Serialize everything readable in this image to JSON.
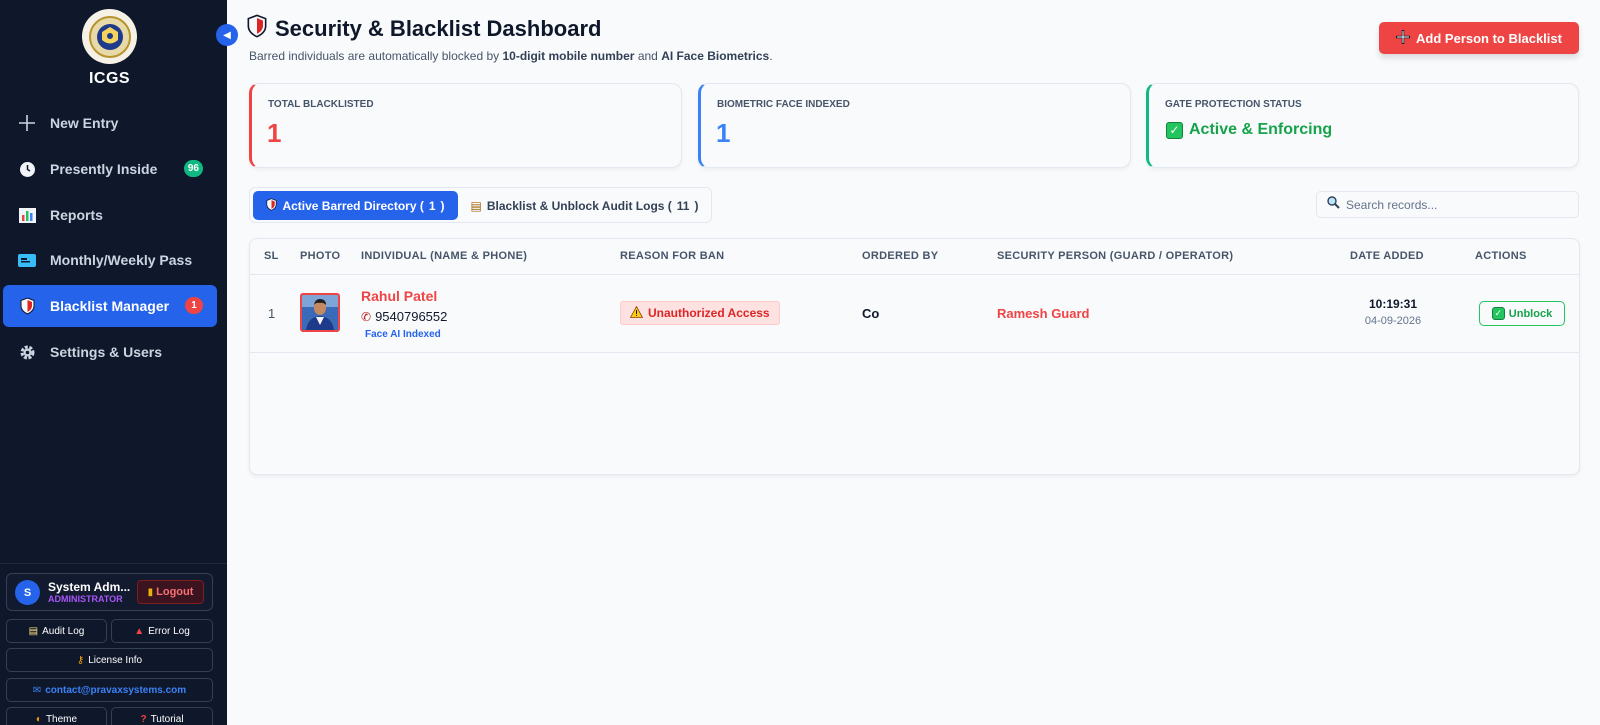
{
  "sidebar": {
    "brand": "ICGS",
    "items": [
      {
        "label": "New Entry",
        "icon": "plus-icon"
      },
      {
        "label": "Presently Inside",
        "icon": "clock-icon",
        "badge": "96",
        "badge_color": "#10b981"
      },
      {
        "label": "Reports",
        "icon": "bar-chart-icon"
      },
      {
        "label": "Monthly/Weekly Pass",
        "icon": "ticket-icon"
      },
      {
        "label": "Blacklist Manager",
        "icon": "shield-icon",
        "badge": "1",
        "badge_color": "#ef4444",
        "active": true
      },
      {
        "label": "Settings & Users",
        "icon": "gear-icon"
      }
    ],
    "user": {
      "initial": "S",
      "name": "System Adm...",
      "role": "ADMINISTRATOR",
      "logout_label": "Logout"
    },
    "footer_buttons": {
      "audit_log": "Audit Log",
      "error_log": "Error Log",
      "license_info": "License Info",
      "email": "contact@pravaxsystems.com",
      "theme": "Theme",
      "tutorial": "Tutorial"
    }
  },
  "header": {
    "title": "Security & Blacklist Dashboard",
    "subtitle_pre": "Barred individuals are automatically blocked by ",
    "subtitle_b1": "10-digit mobile number",
    "subtitle_mid": " and ",
    "subtitle_b2": "AI Face Biometrics",
    "subtitle_post": ".",
    "add_button": "Add Person to Blacklist"
  },
  "stats": [
    {
      "label": "TOTAL BLACKLISTED",
      "value": "1",
      "color": "#ef4444"
    },
    {
      "label": "BIOMETRIC FACE INDEXED",
      "value": "1",
      "color": "#3b82f6"
    },
    {
      "label": "GATE PROTECTION STATUS",
      "value": "Active & Enforcing",
      "color": "#10b981"
    }
  ],
  "tabs": [
    {
      "label": "Active Barred Directory (",
      "count": "1",
      "close": ")",
      "active": true
    },
    {
      "label": "Blacklist & Unblock Audit Logs (",
      "count": "11",
      "close": ")"
    }
  ],
  "search": {
    "placeholder": "Search records..."
  },
  "table": {
    "columns": [
      "SL",
      "PHOTO",
      "INDIVIDUAL (NAME & PHONE)",
      "REASON FOR BAN",
      "ORDERED BY",
      "SECURITY PERSON (GUARD / OPERATOR)",
      "DATE ADDED",
      "ACTIONS"
    ],
    "rows": [
      {
        "sl": "1",
        "name": "Rahul Patel",
        "phone": "9540796552",
        "face_tag": "Face AI Indexed",
        "reason": "Unauthorized Access",
        "ordered_by": "Co",
        "guard": "Ramesh Guard",
        "time": "10:19:31",
        "date": "04-09-2026",
        "action": "Unblock"
      }
    ]
  }
}
